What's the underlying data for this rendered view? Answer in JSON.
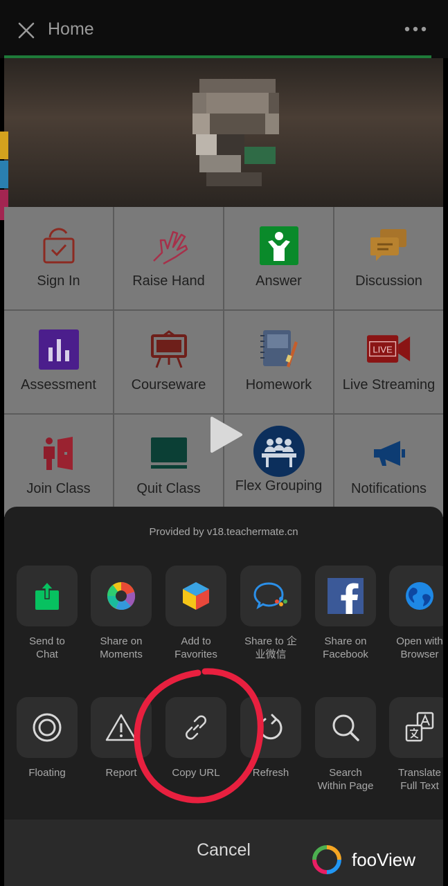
{
  "header": {
    "title": "Home"
  },
  "grid": {
    "items": [
      {
        "label": "Sign In",
        "icon": "sign-in-icon"
      },
      {
        "label": "Raise Hand",
        "icon": "raise-hand-icon"
      },
      {
        "label": "Answer",
        "icon": "answer-icon"
      },
      {
        "label": "Discussion",
        "icon": "discussion-icon"
      },
      {
        "label": "Assessment",
        "icon": "assessment-icon"
      },
      {
        "label": "Courseware",
        "icon": "courseware-icon"
      },
      {
        "label": "Homework",
        "icon": "homework-icon"
      },
      {
        "label": "Live Streaming",
        "icon": "live-streaming-icon"
      },
      {
        "label": "Join Class",
        "icon": "join-class-icon"
      },
      {
        "label": "Quit Class",
        "icon": "quit-class-icon"
      },
      {
        "label": "Flex Grouping",
        "icon": "flex-grouping-icon"
      },
      {
        "label": "Notifications",
        "icon": "notifications-icon"
      }
    ],
    "live_badge": "LIVE"
  },
  "sheet": {
    "provided_by": "Provided by v18.teachermate.cn",
    "row1": [
      {
        "label": "Send to\nChat",
        "icon": "send-to-chat-icon"
      },
      {
        "label": "Share on\nMoments",
        "icon": "moments-icon"
      },
      {
        "label": "Add to\nFavorites",
        "icon": "favorites-icon"
      },
      {
        "label": "Share to 企\n业微信",
        "icon": "wecom-icon"
      },
      {
        "label": "Share on\nFacebook",
        "icon": "facebook-icon"
      },
      {
        "label": "Open with\nBrowser",
        "icon": "browser-icon"
      }
    ],
    "row2": [
      {
        "label": "Floating",
        "icon": "floating-icon"
      },
      {
        "label": "Report",
        "icon": "report-icon"
      },
      {
        "label": "Copy URL",
        "icon": "link-icon"
      },
      {
        "label": "Refresh",
        "icon": "refresh-icon"
      },
      {
        "label": "Search\nWithin Page",
        "icon": "search-icon"
      },
      {
        "label": "Translate\nFull Text",
        "icon": "translate-icon"
      }
    ],
    "cancel": "Cancel",
    "brand": "fooView"
  },
  "colors": {
    "accent_green": "#07c160",
    "annotation_red": "#e8203f"
  }
}
